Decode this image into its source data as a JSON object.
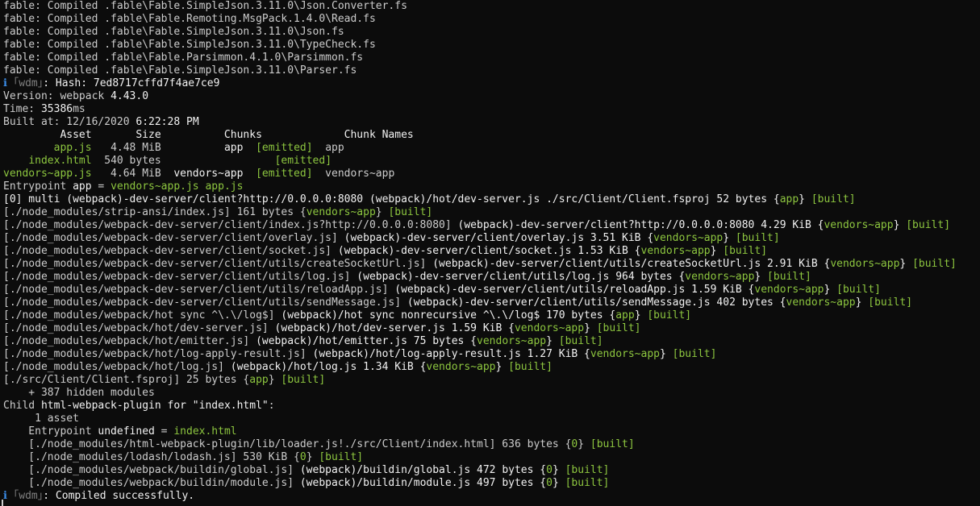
{
  "terminal": {
    "lines": [
      [
        {
          "t": "fable: Compiled .fable\\Fable.SimpleJson.3.11.0\\Json.Converter.fs",
          "c": "default"
        }
      ],
      [
        {
          "t": "fable: Compiled .fable\\Fable.Remoting.MsgPack.1.4.0\\Read.fs",
          "c": "default"
        }
      ],
      [
        {
          "t": "fable: Compiled .fable\\Fable.SimpleJson.3.11.0\\Json.fs",
          "c": "default"
        }
      ],
      [
        {
          "t": "fable: Compiled .fable\\Fable.SimpleJson.3.11.0\\TypeCheck.fs",
          "c": "default"
        }
      ],
      [
        {
          "t": "fable: Compiled .fable\\Fable.Parsimmon.4.1.0\\Parsimmon.fs",
          "c": "default"
        }
      ],
      [
        {
          "t": "fable: Compiled .fable\\Fable.SimpleJson.3.11.0\\Parser.fs",
          "c": "default"
        }
      ],
      [
        {
          "t": "ℹ",
          "c": "blue"
        },
        {
          "t": " ｢wdm｣",
          "c": "gray"
        },
        {
          "t": ": Hash: 7ed8717cffd7f4ae7ce9",
          "c": "white"
        }
      ],
      [
        {
          "t": "Version: webpack ",
          "c": "default"
        },
        {
          "t": "4.43.0",
          "c": "white"
        }
      ],
      [
        {
          "t": "Time: ",
          "c": "default"
        },
        {
          "t": "35386",
          "c": "white"
        },
        {
          "t": "ms",
          "c": "default"
        }
      ],
      [
        {
          "t": "Built at: 12/16/2020 ",
          "c": "default"
        },
        {
          "t": "6:22:28 PM",
          "c": "white"
        }
      ],
      [
        {
          "t": "         Asset       Size          Chunks             Chunk Names",
          "c": "white"
        }
      ],
      [
        {
          "t": "        ",
          "c": "default"
        },
        {
          "t": "app.js",
          "c": "green"
        },
        {
          "t": "   4.48 MiB          ",
          "c": "default"
        },
        {
          "t": "app",
          "c": "white"
        },
        {
          "t": "  ",
          "c": "default"
        },
        {
          "t": "[emitted]",
          "c": "green"
        },
        {
          "t": "  app",
          "c": "default"
        }
      ],
      [
        {
          "t": "    ",
          "c": "default"
        },
        {
          "t": "index.html",
          "c": "green"
        },
        {
          "t": "  540 bytes                  ",
          "c": "default"
        },
        {
          "t": "[emitted]",
          "c": "green"
        }
      ],
      [
        {
          "t": "vendors~app.js",
          "c": "green"
        },
        {
          "t": "   4.64 MiB  ",
          "c": "default"
        },
        {
          "t": "vendors~app",
          "c": "white"
        },
        {
          "t": "  ",
          "c": "default"
        },
        {
          "t": "[emitted]",
          "c": "green"
        },
        {
          "t": "  vendors~app",
          "c": "default"
        }
      ],
      [
        {
          "t": "Entrypoint ",
          "c": "default"
        },
        {
          "t": "app",
          "c": "white"
        },
        {
          "t": " = ",
          "c": "default"
        },
        {
          "t": "vendors~app.js app.js",
          "c": "green"
        }
      ],
      [
        {
          "t": "[0] multi (webpack)-dev-server/client?http://0.0.0.0:8080 (webpack)/hot/dev-server.js ./src/Client/Client.fsproj 52 bytes {",
          "c": "white"
        },
        {
          "t": "app",
          "c": "green"
        },
        {
          "t": "} ",
          "c": "white"
        },
        {
          "t": "[built]",
          "c": "green"
        }
      ],
      [
        {
          "t": "[./node_modules/strip-ansi/index.js] 161 bytes {",
          "c": "default"
        },
        {
          "t": "vendors~app",
          "c": "green"
        },
        {
          "t": "} ",
          "c": "default"
        },
        {
          "t": "[built]",
          "c": "green"
        }
      ],
      [
        {
          "t": "[./node_modules/webpack-dev-server/client/index.js?http://0.0.0.0:8080] ",
          "c": "default"
        },
        {
          "t": "(webpack)-dev-server/client?http://0.0.0.0:8080 4.29 KiB {",
          "c": "white"
        },
        {
          "t": "vendors~app",
          "c": "green"
        },
        {
          "t": "} ",
          "c": "white"
        },
        {
          "t": "[built]",
          "c": "green"
        }
      ],
      [
        {
          "t": "[./node_modules/webpack-dev-server/client/overlay.js] ",
          "c": "default"
        },
        {
          "t": "(webpack)-dev-server/client/overlay.js 3.51 KiB {",
          "c": "white"
        },
        {
          "t": "vendors~app",
          "c": "green"
        },
        {
          "t": "} ",
          "c": "white"
        },
        {
          "t": "[built]",
          "c": "green"
        }
      ],
      [
        {
          "t": "[./node_modules/webpack-dev-server/client/socket.js] ",
          "c": "default"
        },
        {
          "t": "(webpack)-dev-server/client/socket.js 1.53 KiB {",
          "c": "white"
        },
        {
          "t": "vendors~app",
          "c": "green"
        },
        {
          "t": "} ",
          "c": "white"
        },
        {
          "t": "[built]",
          "c": "green"
        }
      ],
      [
        {
          "t": "[./node_modules/webpack-dev-server/client/utils/createSocketUrl.js] ",
          "c": "default"
        },
        {
          "t": "(webpack)-dev-server/client/utils/createSocketUrl.js 2.91 KiB {",
          "c": "white"
        },
        {
          "t": "vendors~app",
          "c": "green"
        },
        {
          "t": "} ",
          "c": "white"
        },
        {
          "t": "[built]",
          "c": "green"
        }
      ],
      [
        {
          "t": "[./node_modules/webpack-dev-server/client/utils/log.js] ",
          "c": "default"
        },
        {
          "t": "(webpack)-dev-server/client/utils/log.js 964 bytes {",
          "c": "white"
        },
        {
          "t": "vendors~app",
          "c": "green"
        },
        {
          "t": "} ",
          "c": "white"
        },
        {
          "t": "[built]",
          "c": "green"
        }
      ],
      [
        {
          "t": "[./node_modules/webpack-dev-server/client/utils/reloadApp.js] ",
          "c": "default"
        },
        {
          "t": "(webpack)-dev-server/client/utils/reloadApp.js 1.59 KiB {",
          "c": "white"
        },
        {
          "t": "vendors~app",
          "c": "green"
        },
        {
          "t": "} ",
          "c": "white"
        },
        {
          "t": "[built]",
          "c": "green"
        }
      ],
      [
        {
          "t": "[./node_modules/webpack-dev-server/client/utils/sendMessage.js] ",
          "c": "default"
        },
        {
          "t": "(webpack)-dev-server/client/utils/sendMessage.js 402 bytes {",
          "c": "white"
        },
        {
          "t": "vendors~app",
          "c": "green"
        },
        {
          "t": "} ",
          "c": "white"
        },
        {
          "t": "[built]",
          "c": "green"
        }
      ],
      [
        {
          "t": "[./node_modules/webpack/hot sync ^\\.\\/log$] ",
          "c": "default"
        },
        {
          "t": "(webpack)/hot sync nonrecursive ^\\.\\/log$ 170 bytes {",
          "c": "white"
        },
        {
          "t": "app",
          "c": "green"
        },
        {
          "t": "} ",
          "c": "white"
        },
        {
          "t": "[built]",
          "c": "green"
        }
      ],
      [
        {
          "t": "[./node_modules/webpack/hot/dev-server.js] ",
          "c": "default"
        },
        {
          "t": "(webpack)/hot/dev-server.js 1.59 KiB {",
          "c": "white"
        },
        {
          "t": "vendors~app",
          "c": "green"
        },
        {
          "t": "} ",
          "c": "white"
        },
        {
          "t": "[built]",
          "c": "green"
        }
      ],
      [
        {
          "t": "[./node_modules/webpack/hot/emitter.js] ",
          "c": "default"
        },
        {
          "t": "(webpack)/hot/emitter.js 75 bytes {",
          "c": "white"
        },
        {
          "t": "vendors~app",
          "c": "green"
        },
        {
          "t": "} ",
          "c": "white"
        },
        {
          "t": "[built]",
          "c": "green"
        }
      ],
      [
        {
          "t": "[./node_modules/webpack/hot/log-apply-result.js] ",
          "c": "default"
        },
        {
          "t": "(webpack)/hot/log-apply-result.js 1.27 KiB {",
          "c": "white"
        },
        {
          "t": "vendors~app",
          "c": "green"
        },
        {
          "t": "} ",
          "c": "white"
        },
        {
          "t": "[built]",
          "c": "green"
        }
      ],
      [
        {
          "t": "[./node_modules/webpack/hot/log.js] ",
          "c": "default"
        },
        {
          "t": "(webpack)/hot/log.js 1.34 KiB {",
          "c": "white"
        },
        {
          "t": "vendors~app",
          "c": "green"
        },
        {
          "t": "} ",
          "c": "white"
        },
        {
          "t": "[built]",
          "c": "green"
        }
      ],
      [
        {
          "t": "[./src/Client/Client.fsproj] 25 bytes {",
          "c": "default"
        },
        {
          "t": "app",
          "c": "green"
        },
        {
          "t": "} ",
          "c": "default"
        },
        {
          "t": "[built]",
          "c": "green"
        }
      ],
      [
        {
          "t": "    + 387 hidden modules",
          "c": "default"
        }
      ],
      [
        {
          "t": "Child ",
          "c": "default"
        },
        {
          "t": "html-webpack-plugin for \"index.html\"",
          "c": "white"
        },
        {
          "t": ":",
          "c": "default"
        }
      ],
      [
        {
          "t": "     1 asset",
          "c": "default"
        }
      ],
      [
        {
          "t": "    Entrypoint ",
          "c": "default"
        },
        {
          "t": "undefined",
          "c": "white"
        },
        {
          "t": " = ",
          "c": "default"
        },
        {
          "t": "index.html",
          "c": "green"
        }
      ],
      [
        {
          "t": "    [./node_modules/html-webpack-plugin/lib/loader.js!./src/Client/index.html] 636 bytes {",
          "c": "default"
        },
        {
          "t": "0",
          "c": "green"
        },
        {
          "t": "} ",
          "c": "default"
        },
        {
          "t": "[built]",
          "c": "green"
        }
      ],
      [
        {
          "t": "    [./node_modules/lodash/lodash.js] 530 KiB {",
          "c": "default"
        },
        {
          "t": "0",
          "c": "green"
        },
        {
          "t": "} ",
          "c": "default"
        },
        {
          "t": "[built]",
          "c": "green"
        }
      ],
      [
        {
          "t": "    [./node_modules/webpack/buildin/global.js] ",
          "c": "default"
        },
        {
          "t": "(webpack)/buildin/global.js 472 bytes {",
          "c": "white"
        },
        {
          "t": "0",
          "c": "green"
        },
        {
          "t": "} ",
          "c": "white"
        },
        {
          "t": "[built]",
          "c": "green"
        }
      ],
      [
        {
          "t": "    [./node_modules/webpack/buildin/module.js] ",
          "c": "default"
        },
        {
          "t": "(webpack)/buildin/module.js 497 bytes {",
          "c": "white"
        },
        {
          "t": "0",
          "c": "green"
        },
        {
          "t": "} ",
          "c": "white"
        },
        {
          "t": "[built]",
          "c": "green"
        }
      ],
      [
        {
          "t": "ℹ",
          "c": "blue"
        },
        {
          "t": " ｢wdm｣",
          "c": "gray"
        },
        {
          "t": ": Compiled successfully.",
          "c": "white"
        }
      ]
    ]
  },
  "colors": {
    "background": "#0c0c0c",
    "default": "#cccccc",
    "white": "#f2f2f2",
    "green": "#8dc63f",
    "blue": "#3b8eea",
    "gray": "#808080"
  }
}
